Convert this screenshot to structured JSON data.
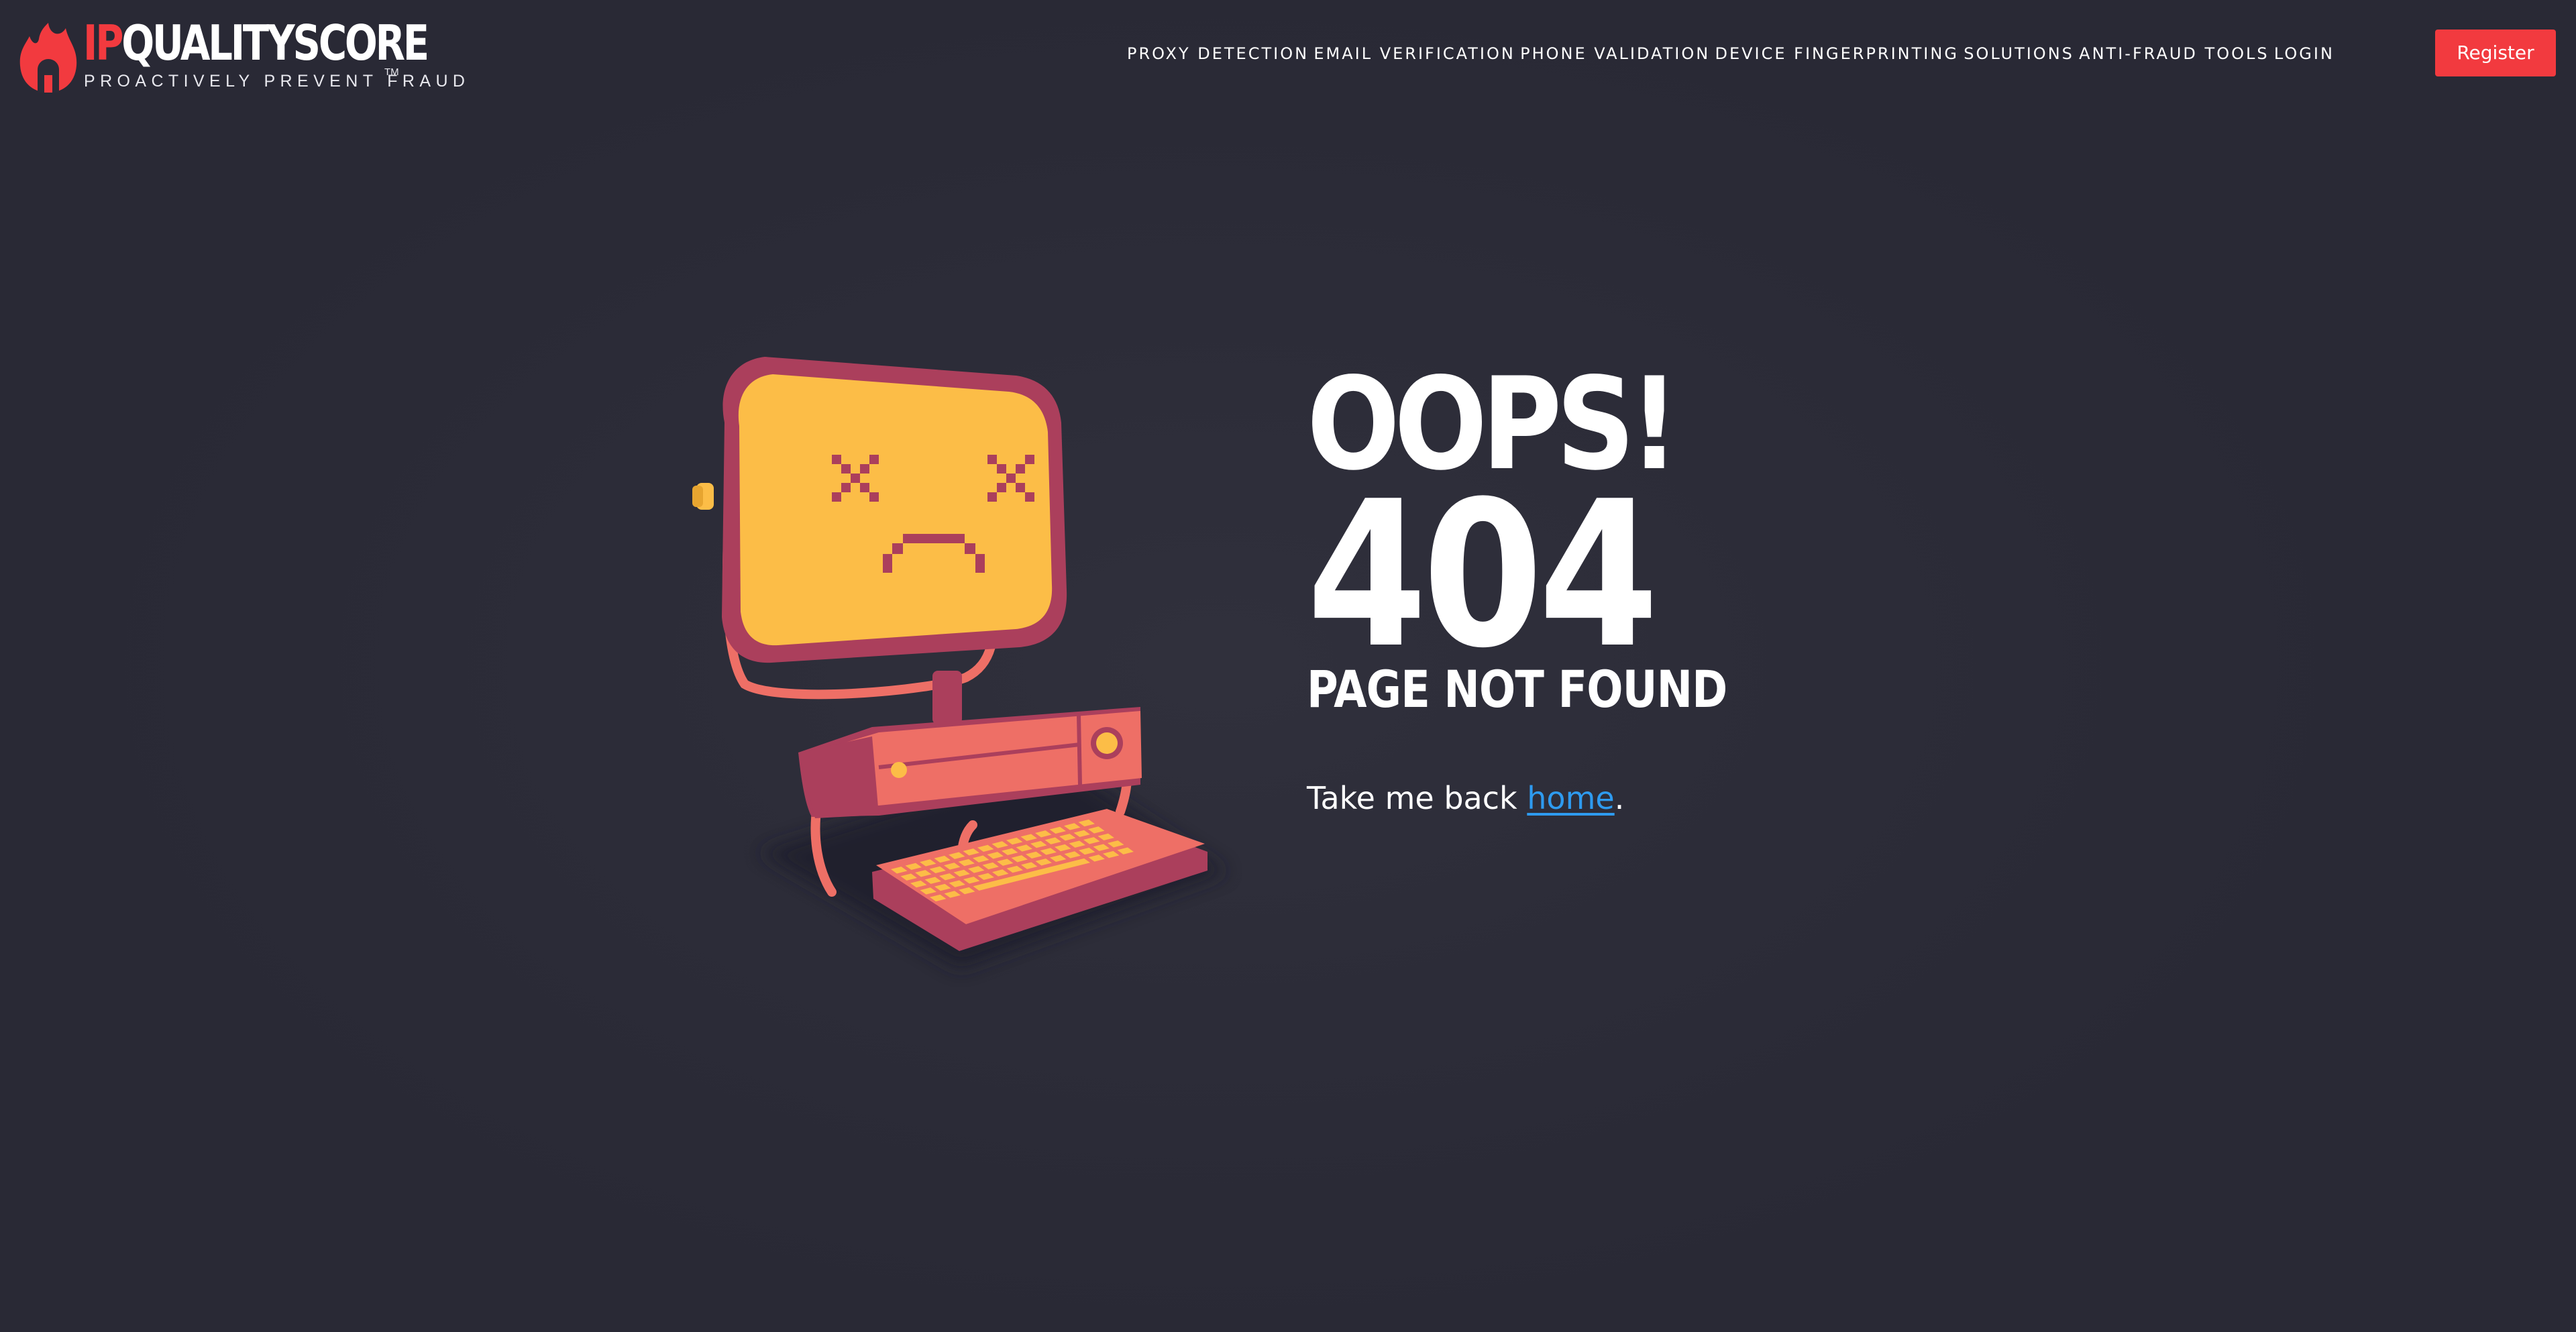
{
  "header": {
    "logo": {
      "wordmark_prefix": "IP",
      "wordmark_suffix": "QUALITYSCORE",
      "tagline": "PROACTIVELY PREVENT FRAUD",
      "trademark": "TM",
      "icon": "flame-logo-icon"
    },
    "nav": [
      {
        "label": "PROXY DETECTION"
      },
      {
        "label": "EMAIL VERIFICATION"
      },
      {
        "label": "PHONE VALIDATION"
      },
      {
        "label": "DEVICE FINGERPRINTING"
      },
      {
        "label": "SOLUTIONS"
      },
      {
        "label": "ANTI-FRAUD TOOLS"
      },
      {
        "label": "LOGIN"
      }
    ],
    "register_label": "Register"
  },
  "error": {
    "headline": "OOPS!",
    "code": "404",
    "message": "PAGE NOT FOUND",
    "back_prefix": "Take me back ",
    "back_link": "home",
    "back_suffix": "."
  },
  "illustration": {
    "icon": "sad-computer-illustration"
  },
  "colors": {
    "background": "#2b2b37",
    "brand_red": "#f23a3f",
    "link_blue": "#2e9bf0",
    "screen_yellow": "#fcbd47",
    "casing_coral": "#ee6f66",
    "casing_dark": "#ab3f5c"
  }
}
